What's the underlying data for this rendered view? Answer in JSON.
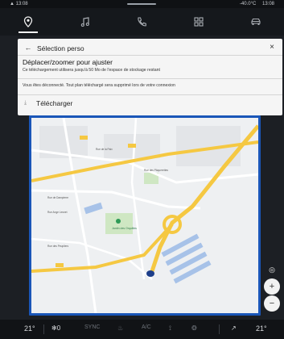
{
  "status": {
    "left_icon": "notification-icon",
    "left_time": "13:08",
    "temperature": "-40.0°C",
    "time": "13:08"
  },
  "nav": {
    "items": [
      {
        "name": "navigation",
        "icon": "location-pin-icon",
        "active": true
      },
      {
        "name": "music",
        "icon": "music-note-icon"
      },
      {
        "name": "phone",
        "icon": "phone-icon"
      },
      {
        "name": "apps",
        "icon": "apps-grid-icon"
      },
      {
        "name": "vehicle",
        "icon": "car-icon"
      }
    ]
  },
  "dialog": {
    "title": "Sélection perso",
    "back_glyph": "←",
    "close_glyph": "×",
    "heading": "Déplacer/zoomer pour ajuster",
    "subtext": "Ce téléchargement utilisera jusqu'à 50 Mo de l'espace de stockage restant",
    "notice": "Vous êtes déconnecté. Tout plan téléchargé sera supprimé lors de votre connexion",
    "download_label": "Télécharger",
    "download_icon_glyph": "⤓"
  },
  "map": {
    "poi_label": "Jardin des Orquilles",
    "street_labels": [
      "Rue de Dampierre",
      "Rue des Pâquerettes",
      "Rue Ange Lesnet",
      "Rue de la Paix",
      "Rue des Peupliers"
    ],
    "zoom_in_glyph": "+",
    "zoom_out_glyph": "−",
    "locate_glyph": "◎"
  },
  "climate": {
    "temp_left": "21°",
    "fan_level": "0",
    "sync_label": "SYNC",
    "ac_label": "A/C",
    "temp_right": "21°"
  },
  "colors": {
    "map_border": "#1a56b8",
    "road_major": "#f5c842",
    "water_blue": "#a7c2e8",
    "park_green": "#cfe7c3"
  }
}
